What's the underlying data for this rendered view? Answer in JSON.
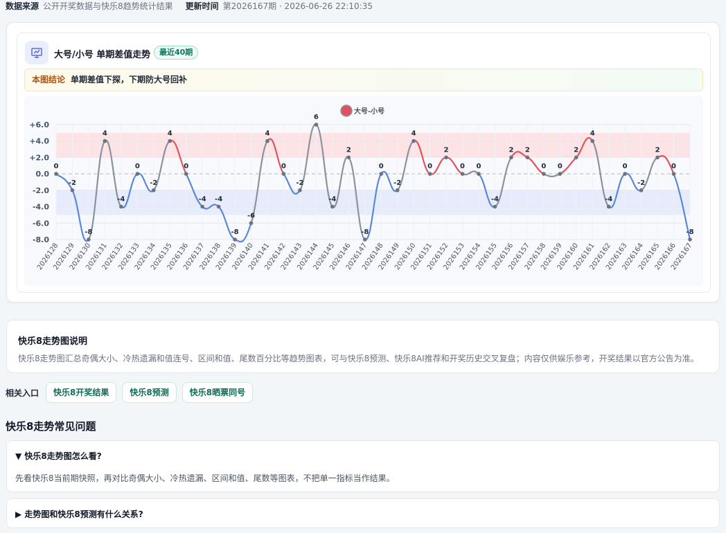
{
  "header": {
    "source_label": "数据来源",
    "source_value": "公开开奖数据与快乐8趋势统计结果",
    "update_label": "更新时间",
    "update_value": "第2026167期 · 2026-06-26 22:10:35"
  },
  "chart_card": {
    "title": "大号/小号 单期差值走势",
    "badge": "最近40期",
    "conclusion_label": "本图结论",
    "conclusion_text": "单期差值下探，下期防大号回补"
  },
  "chart_data": {
    "type": "line",
    "title": "",
    "xlabel": "",
    "ylabel": "",
    "ylim": [
      -8,
      6
    ],
    "yticks": [
      "+6.0",
      "+4.0",
      "+2.0",
      "0.0",
      "-2.0",
      "-4.0",
      "-6.0",
      "-8.0"
    ],
    "legend": {
      "label": "大号-小号",
      "position": "top-center"
    },
    "bands": [
      {
        "from": 2,
        "to": 5,
        "color": "#fbe3e6"
      },
      {
        "from": -5,
        "to": -2,
        "color": "#e6ecfb"
      }
    ],
    "colors": {
      "positive": "#e0535e",
      "negative": "#5b87d8",
      "neutral": "#8a929e",
      "point": "#6b7280"
    },
    "categories": [
      "2026128",
      "2026129",
      "2026130",
      "2026131",
      "2026132",
      "2026133",
      "2026134",
      "2026135",
      "2026136",
      "2026137",
      "2026138",
      "2026139",
      "2026140",
      "2026141",
      "2026142",
      "2026143",
      "2026144",
      "2026145",
      "2026146",
      "2026147",
      "2026148",
      "2026149",
      "2026150",
      "2026151",
      "2026152",
      "2026153",
      "2026154",
      "2026155",
      "2026156",
      "2026157",
      "2026158",
      "2026159",
      "2026160",
      "2026161",
      "2026162",
      "2026163",
      "2026164",
      "2026165",
      "2026166",
      "2026167"
    ],
    "series": [
      {
        "name": "大号-小号",
        "values": [
          0,
          -2,
          -8,
          4,
          -4,
          0,
          -2,
          4,
          0,
          -4,
          -4,
          -8,
          -6,
          4,
          0,
          -2,
          6,
          -4,
          2,
          -8,
          0,
          -2,
          4,
          0,
          2,
          0,
          0,
          -4,
          2,
          2,
          0,
          0,
          2,
          4,
          -4,
          0,
          -2,
          2,
          0,
          -8
        ]
      }
    ]
  },
  "description": {
    "title": "快乐8走势图说明",
    "text": "快乐8走势图汇总奇偶大小、冷热遗漏和值连号、区间和值、尾数百分比等趋势图表，可与快乐8预测、快乐8AI推荐和开奖历史交叉复盘；内容仅供娱乐参考，开奖结果以官方公告为准。"
  },
  "related": {
    "label": "相关入口",
    "links": [
      "快乐8开奖结果",
      "快乐8预测",
      "快乐8晒票同号"
    ]
  },
  "faq": {
    "title": "快乐8走势常见问题",
    "items": [
      {
        "marker": "▼",
        "question": "快乐8走势图怎么看?",
        "answer": "先看快乐8当前期快照，再对比奇偶大小、冷热遗漏、区间和值、尾数等图表，不把单一指标当作结果。"
      },
      {
        "marker": "▶",
        "question": "走势图和快乐8预测有什么关系?"
      }
    ]
  }
}
